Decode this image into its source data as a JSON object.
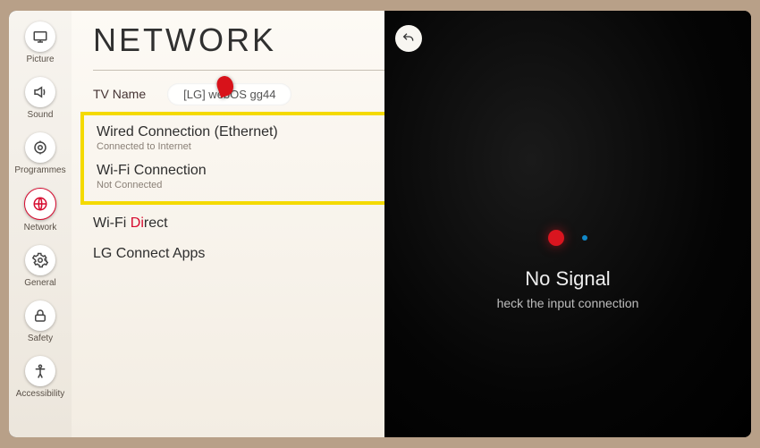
{
  "page_title": "NETWORK",
  "sidebar": {
    "items": [
      {
        "name": "picture",
        "label": "Picture"
      },
      {
        "name": "sound",
        "label": "Sound"
      },
      {
        "name": "programmes",
        "label": "Programmes"
      },
      {
        "name": "network",
        "label": "Network"
      },
      {
        "name": "general",
        "label": "General"
      },
      {
        "name": "safety",
        "label": "Safety"
      },
      {
        "name": "accessibility",
        "label": "Accessibility"
      }
    ],
    "active_index": 3
  },
  "tv_name": {
    "label": "TV Name",
    "value": "[LG] webOS   gg44"
  },
  "network": {
    "wired": {
      "title": "Wired Connection (Ethernet)",
      "status": "Connected to Internet"
    },
    "wifi": {
      "title": "Wi-Fi Connection",
      "status": "Not Connected"
    },
    "wifi_direct_prefix": "Wi-Fi ",
    "wifi_direct_accent": "Di",
    "wifi_direct_suffix": "rect",
    "lg_connect": "LG Connect Apps"
  },
  "backdrop": {
    "no_signal_title": "No Signal",
    "no_signal_sub": "heck the input connection"
  }
}
